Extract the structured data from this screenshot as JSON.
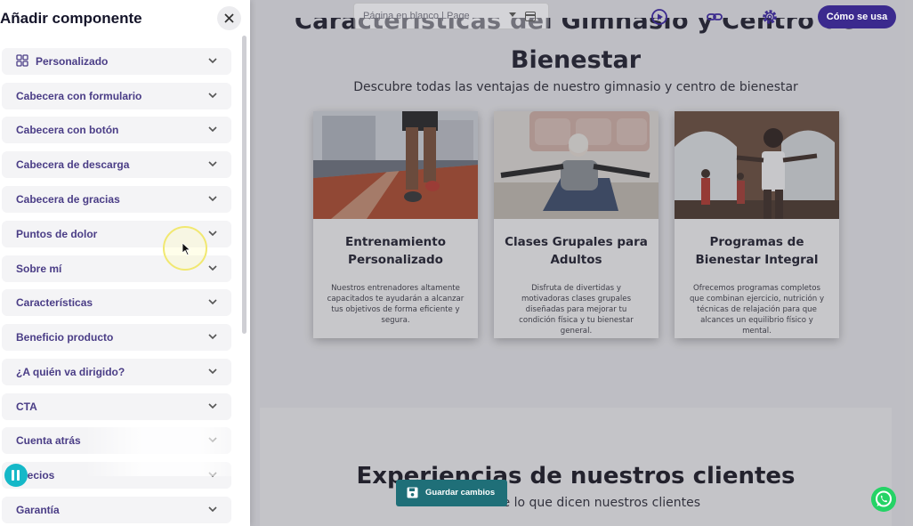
{
  "panel": {
    "title": "Añadir componente",
    "items": [
      {
        "label": "Personalizado",
        "icon": "grid-icon"
      },
      {
        "label": "Cabecera con formulario"
      },
      {
        "label": "Cabecera con botón"
      },
      {
        "label": "Cabecera de descarga"
      },
      {
        "label": "Cabecera de gracias"
      },
      {
        "label": "Puntos de dolor"
      },
      {
        "label": "Sobre mí"
      },
      {
        "label": "Características"
      },
      {
        "label": "Beneficio producto"
      },
      {
        "label": "¿A quién va dirigido?"
      },
      {
        "label": "CTA"
      },
      {
        "label": "Cuenta atrás"
      },
      {
        "label": "Precios"
      },
      {
        "label": "Garantía"
      }
    ]
  },
  "toolbar": {
    "page_select_value": "Página en blanco | Page",
    "how_button_label": "Cómo se usa",
    "icons": [
      "play-icon",
      "link-icon",
      "gear-icon"
    ],
    "accent_color": "#3b2a8e"
  },
  "preview": {
    "heading_partial": "Características del Gimnasio y Centro de",
    "heading_line2": "Bienestar",
    "subtitle": "Descubre todas las ventajas de nuestro gimnasio y centro de bienestar",
    "cards": [
      {
        "title": "Entrenamiento Personalizado",
        "text": "Nuestros entrenadores altamente capacitados te ayudarán a alcanzar tus objetivos de forma eficiente y segura."
      },
      {
        "title": "Clases Grupales para Adultos",
        "text": "Disfruta de divertidas y motivadoras clases grupales diseñadas para mejorar tu condición física y tu bienestar general."
      },
      {
        "title": "Programas de Bienestar Integral",
        "text": "Ofrecemos programas completos que combinan ejercicio, nutrición y técnicas de relajación para que alcances un equilibrio físico y mental."
      }
    ],
    "reviews_title": "Experiencias de nuestros clientes",
    "reviews_subtitle": "Descubre lo que dicen nuestros clientes"
  },
  "save_button_label": "Guardar cambios",
  "colors": {
    "save_button": "#1f6f78",
    "whatsapp": "#25d366",
    "item_text": "#4a3d86"
  }
}
